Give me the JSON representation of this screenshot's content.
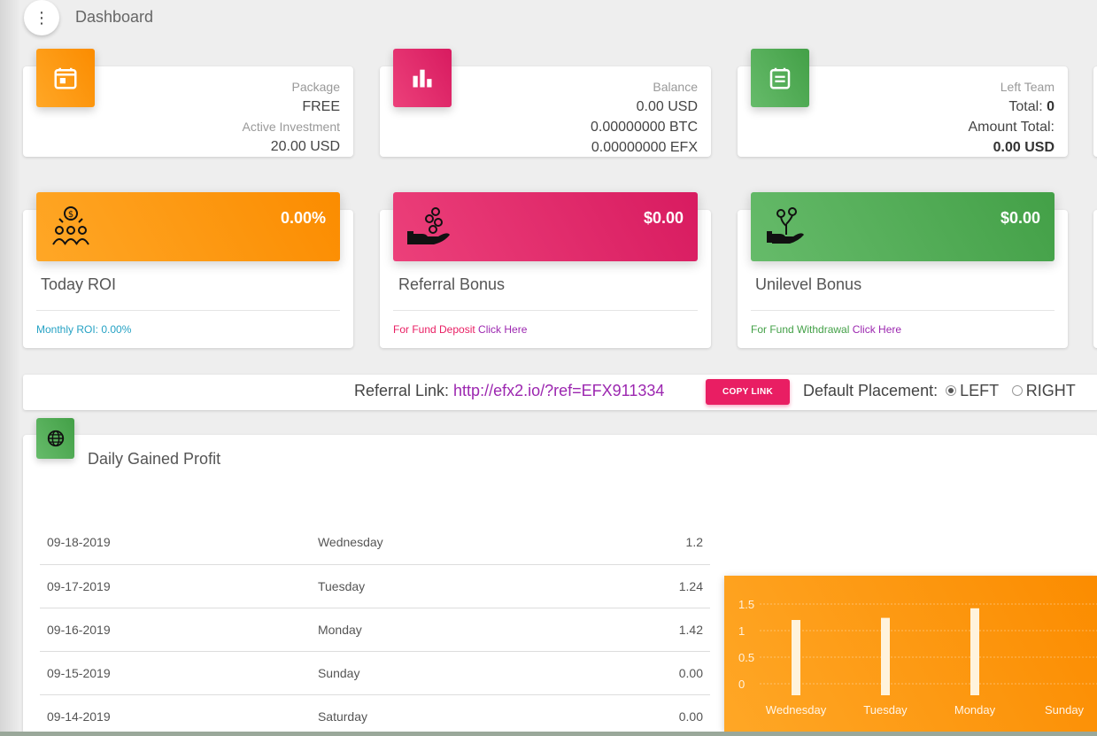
{
  "header": {
    "title": "Dashboard",
    "menu_icon": "more-vertical-icon"
  },
  "stats": [
    {
      "icon": "calendar-icon",
      "color": "#fb8c00",
      "lines": [
        {
          "text": "Package",
          "kind": "cat"
        },
        {
          "text": "FREE",
          "kind": "val"
        },
        {
          "text": "Active Investment",
          "kind": "cat"
        },
        {
          "text": "20.00 USD",
          "kind": "val"
        }
      ]
    },
    {
      "icon": "bar-chart-icon",
      "color": "#d81b60",
      "lines": [
        {
          "text": "Balance",
          "kind": "cat"
        },
        {
          "text": "0.00 USD",
          "kind": "val"
        },
        {
          "text": "0.00000000 BTC",
          "kind": "val"
        },
        {
          "text": "0.00000000 EFX",
          "kind": "val"
        }
      ]
    },
    {
      "icon": "note-icon",
      "color": "#43a047",
      "left_team": {
        "label": "Left Team",
        "total_label": "Total:",
        "total_value": "0",
        "amount_label": "Amount Total:",
        "amount_value": "0.00 USD"
      }
    }
  ],
  "bonuses": [
    {
      "amount": "0.00%",
      "title": "Today ROI",
      "icon": "investors-icon",
      "footer_text": "Monthly ROI: 0.00%",
      "footer_color": "#26a2c4",
      "footer_link": ""
    },
    {
      "amount": "$0.00",
      "title": "Referral Bonus",
      "icon": "hand-coins-icon",
      "footer_text": "For Fund Deposit ",
      "footer_color": "#e91e63",
      "footer_link": "Click Here"
    },
    {
      "amount": "$0.00",
      "title": "Unilevel Bonus",
      "icon": "plant-hand-icon",
      "footer_text": "For Fund Withdrawal ",
      "footer_color": "#43a047",
      "footer_link": "Click Here"
    }
  ],
  "referral": {
    "label": "Referral Link: ",
    "url": "http://efx2.io/?ref=EFX911334",
    "copy_label": "COPY LINK",
    "placement_label": "Default Placement:",
    "options": [
      "LEFT",
      "RIGHT"
    ],
    "selected": "LEFT"
  },
  "profit": {
    "title": "Daily Gained Profit",
    "icon": "globe-icon",
    "rows": [
      {
        "date": "09-18-2019",
        "day": "Wednesday",
        "value": "1.2"
      },
      {
        "date": "09-17-2019",
        "day": "Tuesday",
        "value": "1.24"
      },
      {
        "date": "09-16-2019",
        "day": "Monday",
        "value": "1.42"
      },
      {
        "date": "09-15-2019",
        "day": "Sunday",
        "value": "0.00"
      },
      {
        "date": "09-14-2019",
        "day": "Saturday",
        "value": "0.00"
      }
    ]
  },
  "chart_data": {
    "type": "bar",
    "categories": [
      "Wednesday",
      "Tuesday",
      "Monday",
      "Sunday"
    ],
    "values": [
      1.2,
      1.24,
      1.42,
      0
    ],
    "yticks": [
      "1.5",
      "1",
      "0.5",
      "0"
    ],
    "ylim": [
      0,
      1.5
    ],
    "grid": true,
    "bar_color": "#fff3dc",
    "background": "#fb8c00"
  }
}
